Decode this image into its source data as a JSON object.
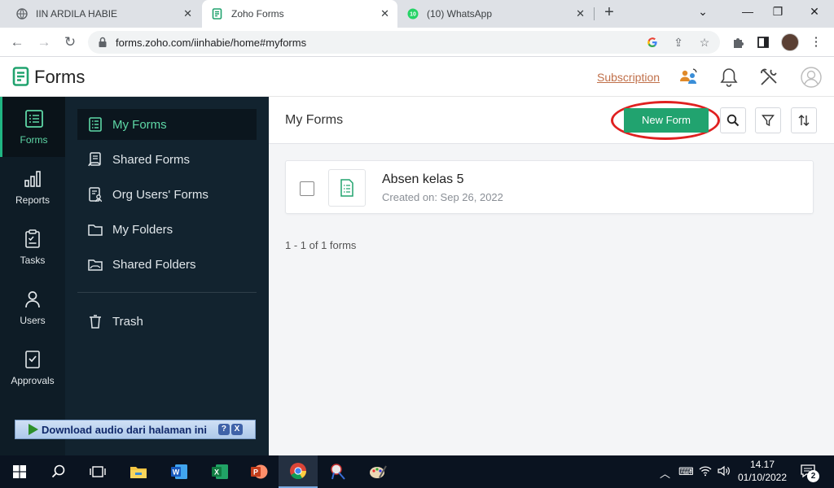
{
  "browser": {
    "tabs": [
      {
        "title": "IIN ARDILA HABIE",
        "active": false
      },
      {
        "title": "Zoho Forms",
        "active": true
      },
      {
        "title": "(10) WhatsApp",
        "active": false
      }
    ],
    "whatsapp_badge": "10",
    "url": "forms.zoho.com/iinhabie/home#myforms"
  },
  "app": {
    "title": "Forms",
    "subscription_label": "Subscription"
  },
  "rail": {
    "items": [
      {
        "label": "Forms",
        "active": true
      },
      {
        "label": "Reports"
      },
      {
        "label": "Tasks"
      },
      {
        "label": "Users"
      },
      {
        "label": "Approvals"
      }
    ]
  },
  "sidebar": {
    "items": [
      {
        "label": "My Forms",
        "active": true
      },
      {
        "label": "Shared Forms"
      },
      {
        "label": "Org Users' Forms"
      },
      {
        "label": "My Folders"
      },
      {
        "label": "Shared Folders"
      }
    ],
    "trash_label": "Trash"
  },
  "download_bar": {
    "label": "Download audio dari halaman ini",
    "help": "?",
    "close": "X"
  },
  "main": {
    "title": "My Forms",
    "new_form_label": "New Form",
    "forms": [
      {
        "name": "Absen kelas 5",
        "created": "Created on: Sep 26, 2022"
      }
    ],
    "pager": "1 - 1 of 1 forms"
  },
  "taskbar": {
    "time": "14.17",
    "date": "01/10/2022",
    "notification_count": "2"
  },
  "colors": {
    "accent": "#21a36f",
    "rail_bg": "#0e1c26",
    "sidebar_bg": "#12232f",
    "annotation": "#e02020"
  }
}
